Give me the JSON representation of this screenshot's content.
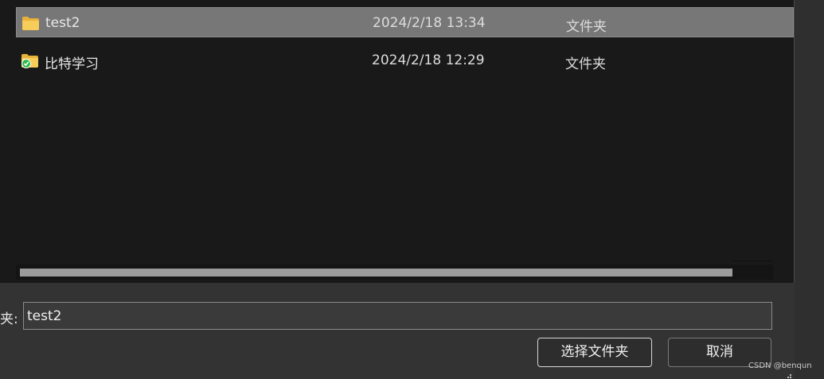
{
  "files": [
    {
      "name": "test2",
      "date": "2024/2/18 13:34",
      "type": "文件夹",
      "icon": "folder-icon",
      "selected": true
    },
    {
      "name": "比特学习",
      "date": "2024/2/18 12:29",
      "type": "文件夹",
      "icon": "folder-synced-icon",
      "selected": false
    }
  ],
  "footer": {
    "folder_label": "夹:",
    "folder_value": "test2",
    "select_button": "选择文件夹",
    "cancel_button": "取消"
  },
  "watermark": "CSDN @benqun",
  "colors": {
    "list_background": "#191919",
    "selected_row": "#777777",
    "dialog_background": "#333333",
    "folder_yellow": "#f3c64a",
    "sync_green": "#2db84a"
  }
}
